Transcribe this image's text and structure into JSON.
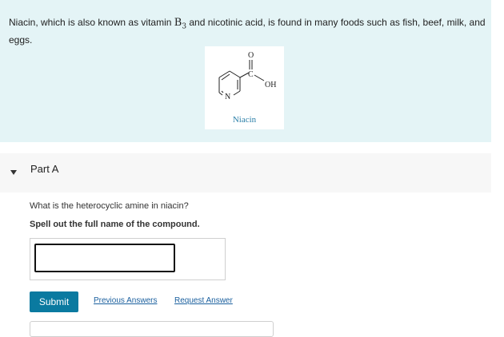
{
  "intro": {
    "text_before": "Niacin, which is also known as vitamin ",
    "vitamin_letter": "B",
    "vitamin_sub": "3",
    "text_after": " and nicotinic acid, is found in many foods such as fish, beef, milk, and eggs.",
    "molecule": {
      "label": "Niacin",
      "atom_o": "O",
      "atom_c": "C",
      "atom_oh": "OH",
      "atom_n": "N",
      "icon": "niacin-structure-icon"
    }
  },
  "part_a": {
    "title": "Part A",
    "question": "What is the heterocyclic amine in niacin?",
    "instruction": "Spell out the full name of the compound.",
    "answer_value": "",
    "submit_label": "Submit",
    "previous_answers_label": "Previous Answers",
    "request_answer_label": "Request Answer"
  },
  "colors": {
    "intro_bg": "#e4f4f6",
    "submit_bg": "#0a7aa0",
    "link": "#1a5f9e",
    "molecule_label": "#2b7fa8"
  }
}
